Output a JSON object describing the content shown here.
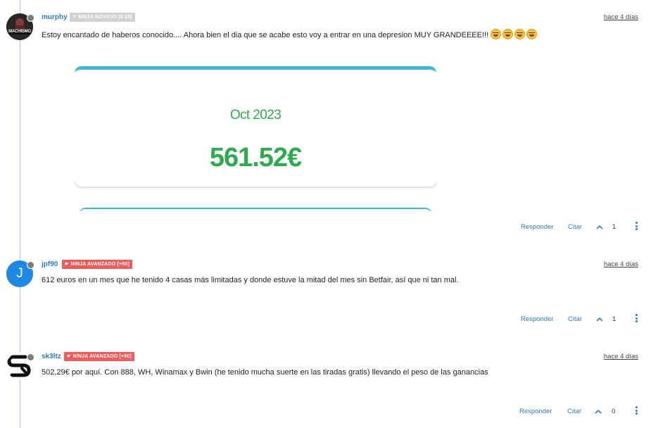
{
  "posts": [
    {
      "username": "murphy",
      "badge": "NINJA NOVICIO [0-15]",
      "timestamp": "hace 4 días",
      "text": "Estoy encantado de haberos conocido.... Ahora bien el dia que se acabe esto voy a entrar en una depresion MUY GRANDEEEE!!!",
      "emojis": [
        "rolling-laughing-emoji",
        "rolling-laughing-emoji",
        "rolling-laughing-emoji",
        "rolling-laughing-emoji"
      ],
      "avatar_text": "MACHISMO",
      "image_card": {
        "month": "Oct 2023",
        "amount": "561.52€"
      },
      "reply_label": "Responder",
      "quote_label": "Citar",
      "votes": "1"
    },
    {
      "username": "jpf90",
      "badge": "NINJA AVANZADO [+50]",
      "timestamp": "hace 4 días",
      "text": "612 euros en un mes que he tenido 4 casas más limitadas y donde estuve la mitad del mes sin Betfair, así que ni tan mal.",
      "avatar_letter": "J",
      "avatar_color": "#1e88e5",
      "reply_label": "Responder",
      "quote_label": "Citar",
      "votes": "1"
    },
    {
      "username": "sk3ltz",
      "badge": "NINJA AVANZADO [+50]",
      "timestamp": "hace 4 días",
      "text": "502,29€ por aquí. Con 888, WH, Winamax y Bwin (he tenido mucha suerte en las tiradas gratis) llevando el peso de las ganancias",
      "reply_label": "Responder",
      "quote_label": "Citar",
      "votes": "0"
    }
  ],
  "colors": {
    "link": "#337ab7",
    "badge_novicio": "#d1d1d1",
    "badge_avanzado": "#ef5c5c",
    "card_green": "#2eab4c",
    "card_accent": "#3fb8d8"
  }
}
